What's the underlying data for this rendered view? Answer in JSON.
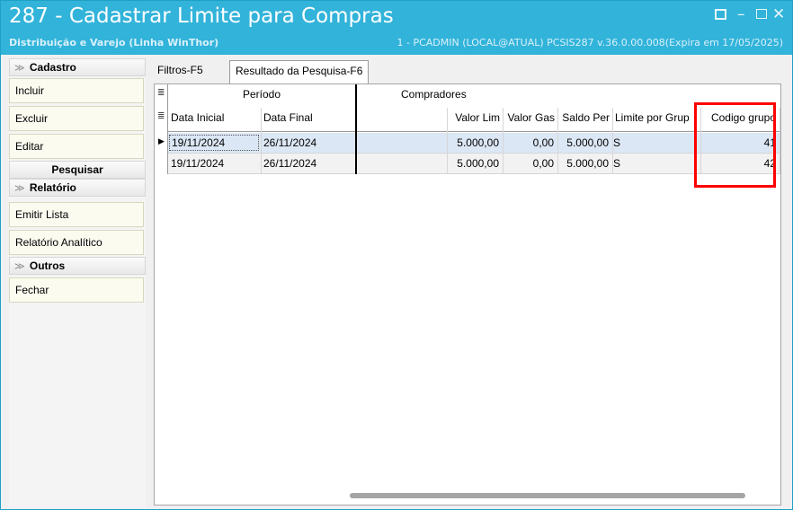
{
  "window": {
    "title": "287 - Cadastrar Limite para Compras",
    "subtitle_left": "Distribuição e Varejo (Linha WinThor)",
    "subtitle_right": "1 - PCADMIN (LOCAL@ATUAL)   PCSIS287  v.36.0.00.008(Expira em 17/05/2025)",
    "controls": {
      "restore": "restore-icon",
      "minimize": "–",
      "maximize": "maximize-icon",
      "close": "✕"
    }
  },
  "sidebar": {
    "cadastro": {
      "title": "Cadastro",
      "items": [
        "Incluir",
        "Excluir",
        "Editar"
      ]
    },
    "pesquisar": {
      "title": "Pesquisar"
    },
    "relatorio": {
      "title": "Relatório",
      "items": [
        "Emitir Lista",
        "Relatório Analítico"
      ]
    },
    "outros": {
      "title": "Outros",
      "items": [
        "Fechar"
      ]
    },
    "chevron": "≫"
  },
  "tabs": [
    "Filtros-F5",
    "Resultado da Pesquisa-F6"
  ],
  "grid": {
    "group_headers": {
      "periodo": "Período",
      "compradores": "Compradores"
    },
    "columns": [
      "Data Inicial",
      "Data Final",
      "",
      "Valor Lim",
      "Valor Gas",
      "Saldo Per",
      "Limite por Grup",
      "Codigo grupo"
    ],
    "rows": [
      {
        "data_inicial": "19/11/2024",
        "data_final": "26/11/2024",
        "compradores": "",
        "valor_lim": "5.000,00",
        "valor_gas": "0,00",
        "saldo_per": "5.000,00",
        "limite_grupo": "S",
        "codigo_grupo": "41"
      },
      {
        "data_inicial": "19/11/2024",
        "data_final": "26/11/2024",
        "compradores": "",
        "valor_lim": "5.000,00",
        "valor_gas": "0,00",
        "saldo_per": "5.000,00",
        "limite_grupo": "S",
        "codigo_grupo": "42"
      }
    ],
    "row_indicator": "▶",
    "column_menu_icon": "≣"
  },
  "colors": {
    "titlebar": "#32b3da",
    "selected_row": "#dce7f5",
    "highlight": "#ff0000"
  }
}
